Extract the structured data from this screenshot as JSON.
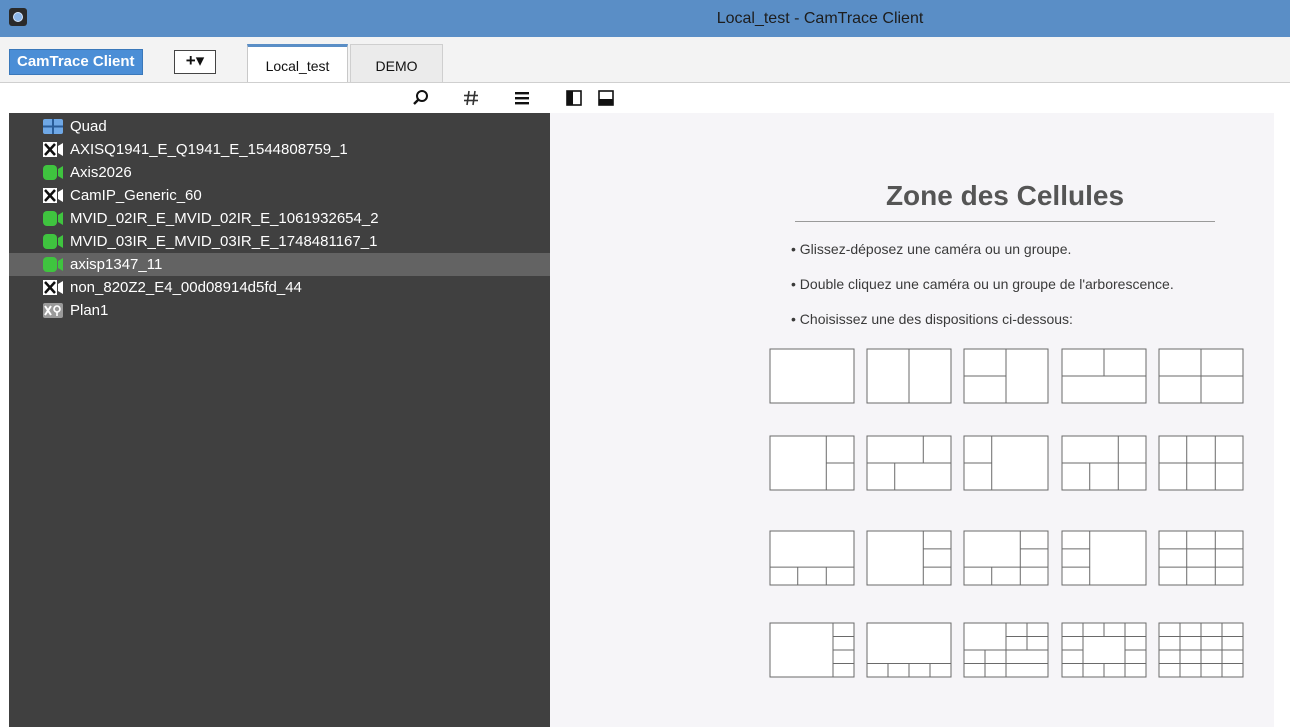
{
  "window": {
    "title": "Local_test - CamTrace Client"
  },
  "topbar": {
    "brand_label": "CamTrace Client",
    "add_label": "+▾",
    "tabs": [
      {
        "label": "Local_test",
        "active": true
      },
      {
        "label": "DEMO",
        "active": false
      }
    ]
  },
  "toolbar": {
    "icons": [
      "search-icon",
      "hash-icon",
      "menu-icon",
      "panel-left-icon",
      "panel-bottom-icon"
    ]
  },
  "tree": {
    "items": [
      {
        "label": "Quad",
        "icon": "quad-icon",
        "selected": false
      },
      {
        "label": "AXISQ1941_E_Q1941_E_1544808759_1",
        "icon": "camera-offline-icon",
        "selected": false
      },
      {
        "label": "Axis2026",
        "icon": "camera-online-icon",
        "selected": false
      },
      {
        "label": "CamIP_Generic_60",
        "icon": "camera-offline-icon",
        "selected": false
      },
      {
        "label": "MVID_02IR_E_MVID_02IR_E_1061932654_2",
        "icon": "camera-online-icon",
        "selected": false
      },
      {
        "label": "MVID_03IR_E_MVID_03IR_E_1748481167_1",
        "icon": "camera-online-icon",
        "selected": false
      },
      {
        "label": "axisp1347_11",
        "icon": "camera-online-icon",
        "selected": true
      },
      {
        "label": "non_820Z2_E4_00d08914d5fd_44",
        "icon": "camera-offline-icon",
        "selected": false
      },
      {
        "label": "Plan1",
        "icon": "plan-icon",
        "selected": false
      }
    ]
  },
  "zone": {
    "title": "Zone des Cellules",
    "hints": [
      "• Glissez-déposez une caméra ou un groupe.",
      "• Double cliquez une caméra ou un groupe de l'arborescence.",
      "• Choisissez une des dispositions ci-dessous:"
    ],
    "layout_count": 20
  },
  "colors": {
    "titlebar": "#5a8ec6",
    "tree_bg": "#404040",
    "tree_selected": "#636363",
    "camera_online": "#3fc43f",
    "brand_button": "#4b8ed6"
  }
}
